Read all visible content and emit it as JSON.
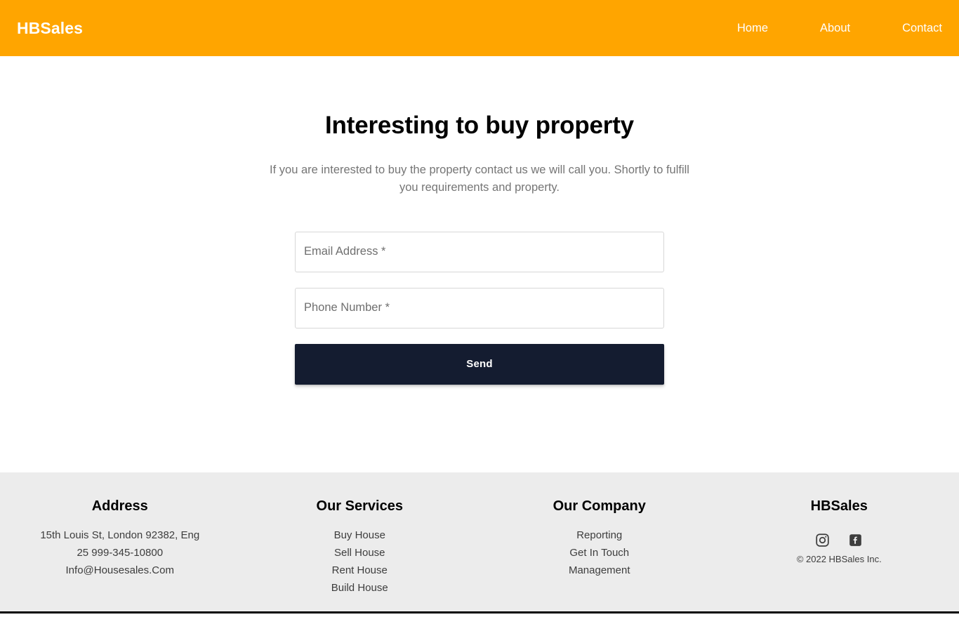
{
  "header": {
    "brand": "HBSales",
    "nav": [
      {
        "label": "Home",
        "name": "nav-link-home"
      },
      {
        "label": "About",
        "name": "nav-link-about"
      },
      {
        "label": "Contact",
        "name": "nav-link-contact"
      }
    ],
    "background_color": "#ffa500",
    "text_color": "#ffffff"
  },
  "main": {
    "title": "Interesting to buy property",
    "subtitle": "If you are interested to buy the property contact us we will call you. Shortly to fulfill you requirements and property.",
    "form": {
      "email_placeholder": "Email Address *",
      "email_value": "",
      "phone_placeholder": "Phone Number *",
      "phone_value": "",
      "submit_label": "Send",
      "submit_color": "#141c30"
    }
  },
  "footer": {
    "background_color": "#ececec",
    "address": {
      "heading": "Address",
      "lines": [
        "15th Louis St, London 92382, Eng",
        "25 999-345-10800",
        "Info@Housesales.Com"
      ]
    },
    "services": {
      "heading": "Our Services",
      "links": [
        "Buy House",
        "Sell House",
        "Rent House",
        "Build House"
      ]
    },
    "company": {
      "heading": "Our Company",
      "links": [
        "Reporting",
        "Get In Touch",
        "Management"
      ]
    },
    "brand_col": {
      "heading": "HBSales",
      "socials": [
        {
          "name": "instagram-icon",
          "label": "Instagram"
        },
        {
          "name": "facebook-icon",
          "label": "Facebook"
        }
      ],
      "copyright": "© 2022 HBSales Inc."
    }
  }
}
